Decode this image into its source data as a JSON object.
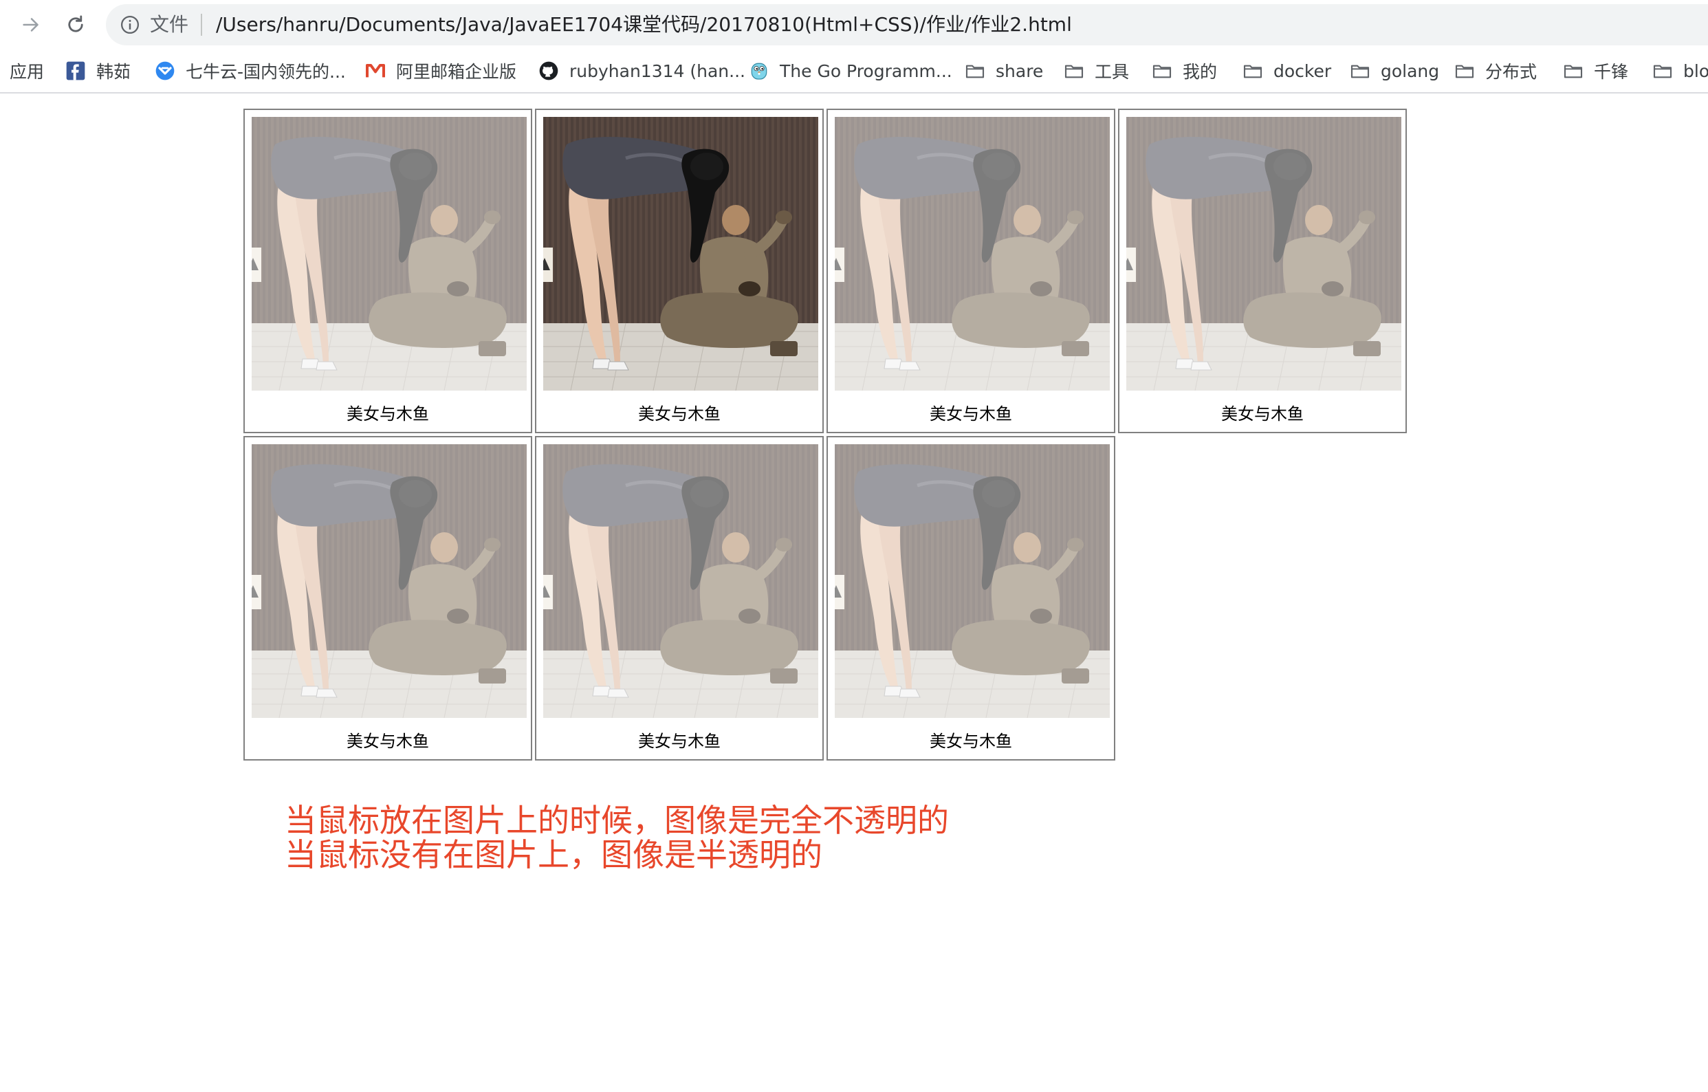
{
  "browser": {
    "scheme_label": "文件",
    "url": "/Users/hanru/Documents/Java/JavaEE1704课堂代码/20170810(Html+CSS)/作业/作业2.html"
  },
  "bookmarks": [
    {
      "label": "应用",
      "icon": "apps-icon"
    },
    {
      "label": "韩茹",
      "icon": "facebook-icon"
    },
    {
      "label": "七牛云-国内领先的...",
      "icon": "qiniu-icon"
    },
    {
      "label": "阿里邮箱企业版",
      "icon": "aliyun-mail-icon"
    },
    {
      "label": "rubyhan1314 (han...",
      "icon": "github-icon"
    },
    {
      "label": "The Go Programm...",
      "icon": "gopher-icon"
    },
    {
      "label": "share",
      "icon": "folder-icon"
    },
    {
      "label": "工具",
      "icon": "folder-icon"
    },
    {
      "label": "我的",
      "icon": "folder-icon"
    },
    {
      "label": "docker",
      "icon": "folder-icon"
    },
    {
      "label": "golang",
      "icon": "folder-icon"
    },
    {
      "label": "分布式",
      "icon": "folder-icon"
    },
    {
      "label": "千锋",
      "icon": "folder-icon"
    },
    {
      "label": "blo",
      "icon": "folder-icon"
    }
  ],
  "gallery": {
    "items": [
      {
        "caption": "美女与木鱼",
        "opaque": false
      },
      {
        "caption": "美女与木鱼",
        "opaque": true
      },
      {
        "caption": "美女与木鱼",
        "opaque": false
      },
      {
        "caption": "美女与木鱼",
        "opaque": false
      },
      {
        "caption": "美女与木鱼",
        "opaque": false
      },
      {
        "caption": "美女与木鱼",
        "opaque": false
      },
      {
        "caption": "美女与木鱼",
        "opaque": false
      }
    ]
  },
  "note": {
    "line1": "当鼠标放在图片上的时候，图像是完全不透明的",
    "line2": "当鼠标没有在图片上，图像是半透明的",
    "color": "#e8472b"
  }
}
